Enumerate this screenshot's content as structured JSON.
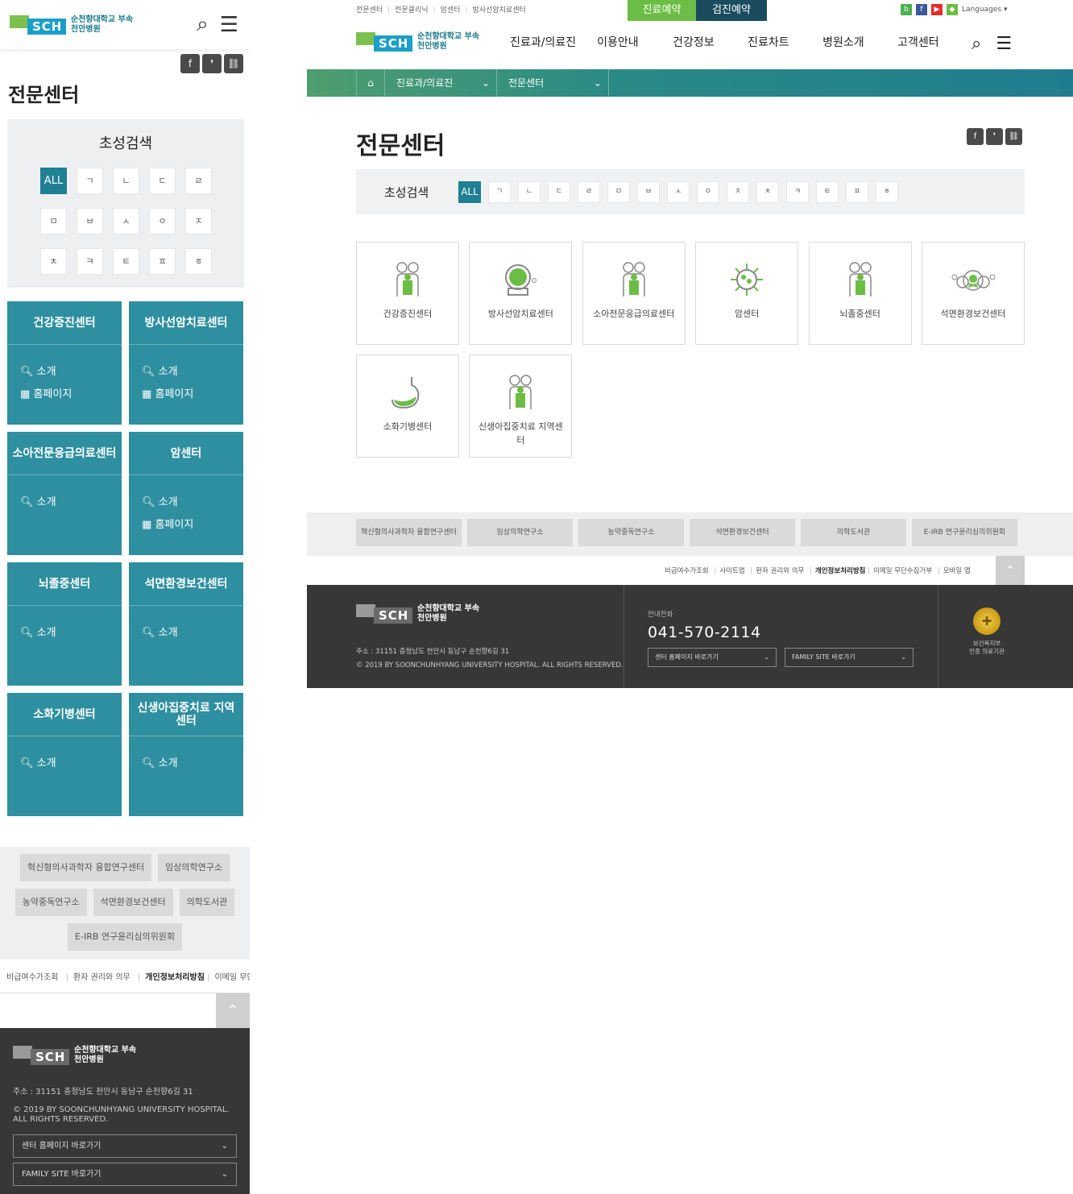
{
  "brand": {
    "logo_mark": "SCH",
    "name_line1": "순천향대학교 부속",
    "name_line2": "천안병원"
  },
  "share_icons": [
    {
      "name": "facebook-icon",
      "glyph": "f"
    },
    {
      "name": "blog-icon",
      "glyph": "❜"
    },
    {
      "name": "link-icon",
      "glyph": "⛓"
    }
  ],
  "page_title": "전문센터",
  "search": {
    "title": "초성검색",
    "consonants": [
      "ALL",
      "ㄱ",
      "ㄴ",
      "ㄷ",
      "ㄹ",
      "ㅁ",
      "ㅂ",
      "ㅅ",
      "ㅇ",
      "ㅈ",
      "ㅊ",
      "ㅋ",
      "ㅌ",
      "ㅍ",
      "ㅎ"
    ]
  },
  "centers": [
    {
      "name": "건강증진센터",
      "intro": "소개",
      "homepage": "홈페이지",
      "icon": "family-icon"
    },
    {
      "name": "방사선암치료센터",
      "intro": "소개",
      "homepage": "홈페이지",
      "icon": "radiation-scanner-icon"
    },
    {
      "name": "소아전문응급의료센터",
      "intro": "소개",
      "homepage": "",
      "icon": "family-icon"
    },
    {
      "name": "암센터",
      "intro": "소개",
      "homepage": "홈페이지",
      "icon": "virus-cell-icon"
    },
    {
      "name": "뇌졸중센터",
      "intro": "소개",
      "homepage": "",
      "icon": "family-icon"
    },
    {
      "name": "석면환경보건센터",
      "intro": "소개",
      "homepage": "",
      "icon": "toxic-cloud-icon"
    },
    {
      "name": "소화기병센터",
      "intro": "소개",
      "homepage": "",
      "icon": "stomach-icon"
    },
    {
      "name": "신생아집중치료 지역센터",
      "intro": "소개",
      "homepage": "",
      "icon": "family-icon"
    }
  ],
  "related_sites": [
    "혁신형의사과학자 융합연구센터",
    "임상의학연구소",
    "농약중독연구소",
    "석면환경보건센터",
    "의학도서관",
    "E-IRB 연구윤리심의위원회"
  ],
  "footer_links": [
    {
      "label": "비급여수가조회",
      "bold": false
    },
    {
      "label": "사이트맵",
      "bold": false
    },
    {
      "label": "환자 권리와 의무",
      "bold": false
    },
    {
      "label": "개인정보처리방침",
      "bold": true
    },
    {
      "label": "이메일 무단수집거부",
      "bold": false
    },
    {
      "label": "모바일 앱",
      "bold": false
    }
  ],
  "footer": {
    "address": "주소 : 31151 충청남도 천안시 동남구 순천향6길 31",
    "copyright": "© 2019 BY SOONCHUNHYANG UNIVERSITY HOSPITAL. ALL RIGHTS RESERVED.",
    "phone_label": "안내전화",
    "phone": "041-570-2114",
    "select_center": "센터 홈페이지 바로가기",
    "select_family": "FAMILY SITE 바로가기",
    "cert_line1": "보건복지부",
    "cert_line2": "인증 의료기관"
  },
  "desktop": {
    "util_links": [
      "전문센터",
      "전문클리닉",
      "암센터",
      "방사선암치료센터"
    ],
    "reserve_treatment": "진료예약",
    "reserve_checkup": "검진예약",
    "languages": "Languages",
    "menu": [
      "진료과/의료진",
      "이용안내",
      "건강정보",
      "진료차트",
      "병원소개",
      "고객센터"
    ],
    "breadcrumb": [
      "진료과/의료진",
      "전문센터"
    ]
  },
  "colors": {
    "primary_teal": "#2e8fa0",
    "active_teal": "#1f7f93",
    "green": "#6cbd45",
    "dark_navy": "#1a4c5e",
    "footer_bg": "#373737"
  }
}
